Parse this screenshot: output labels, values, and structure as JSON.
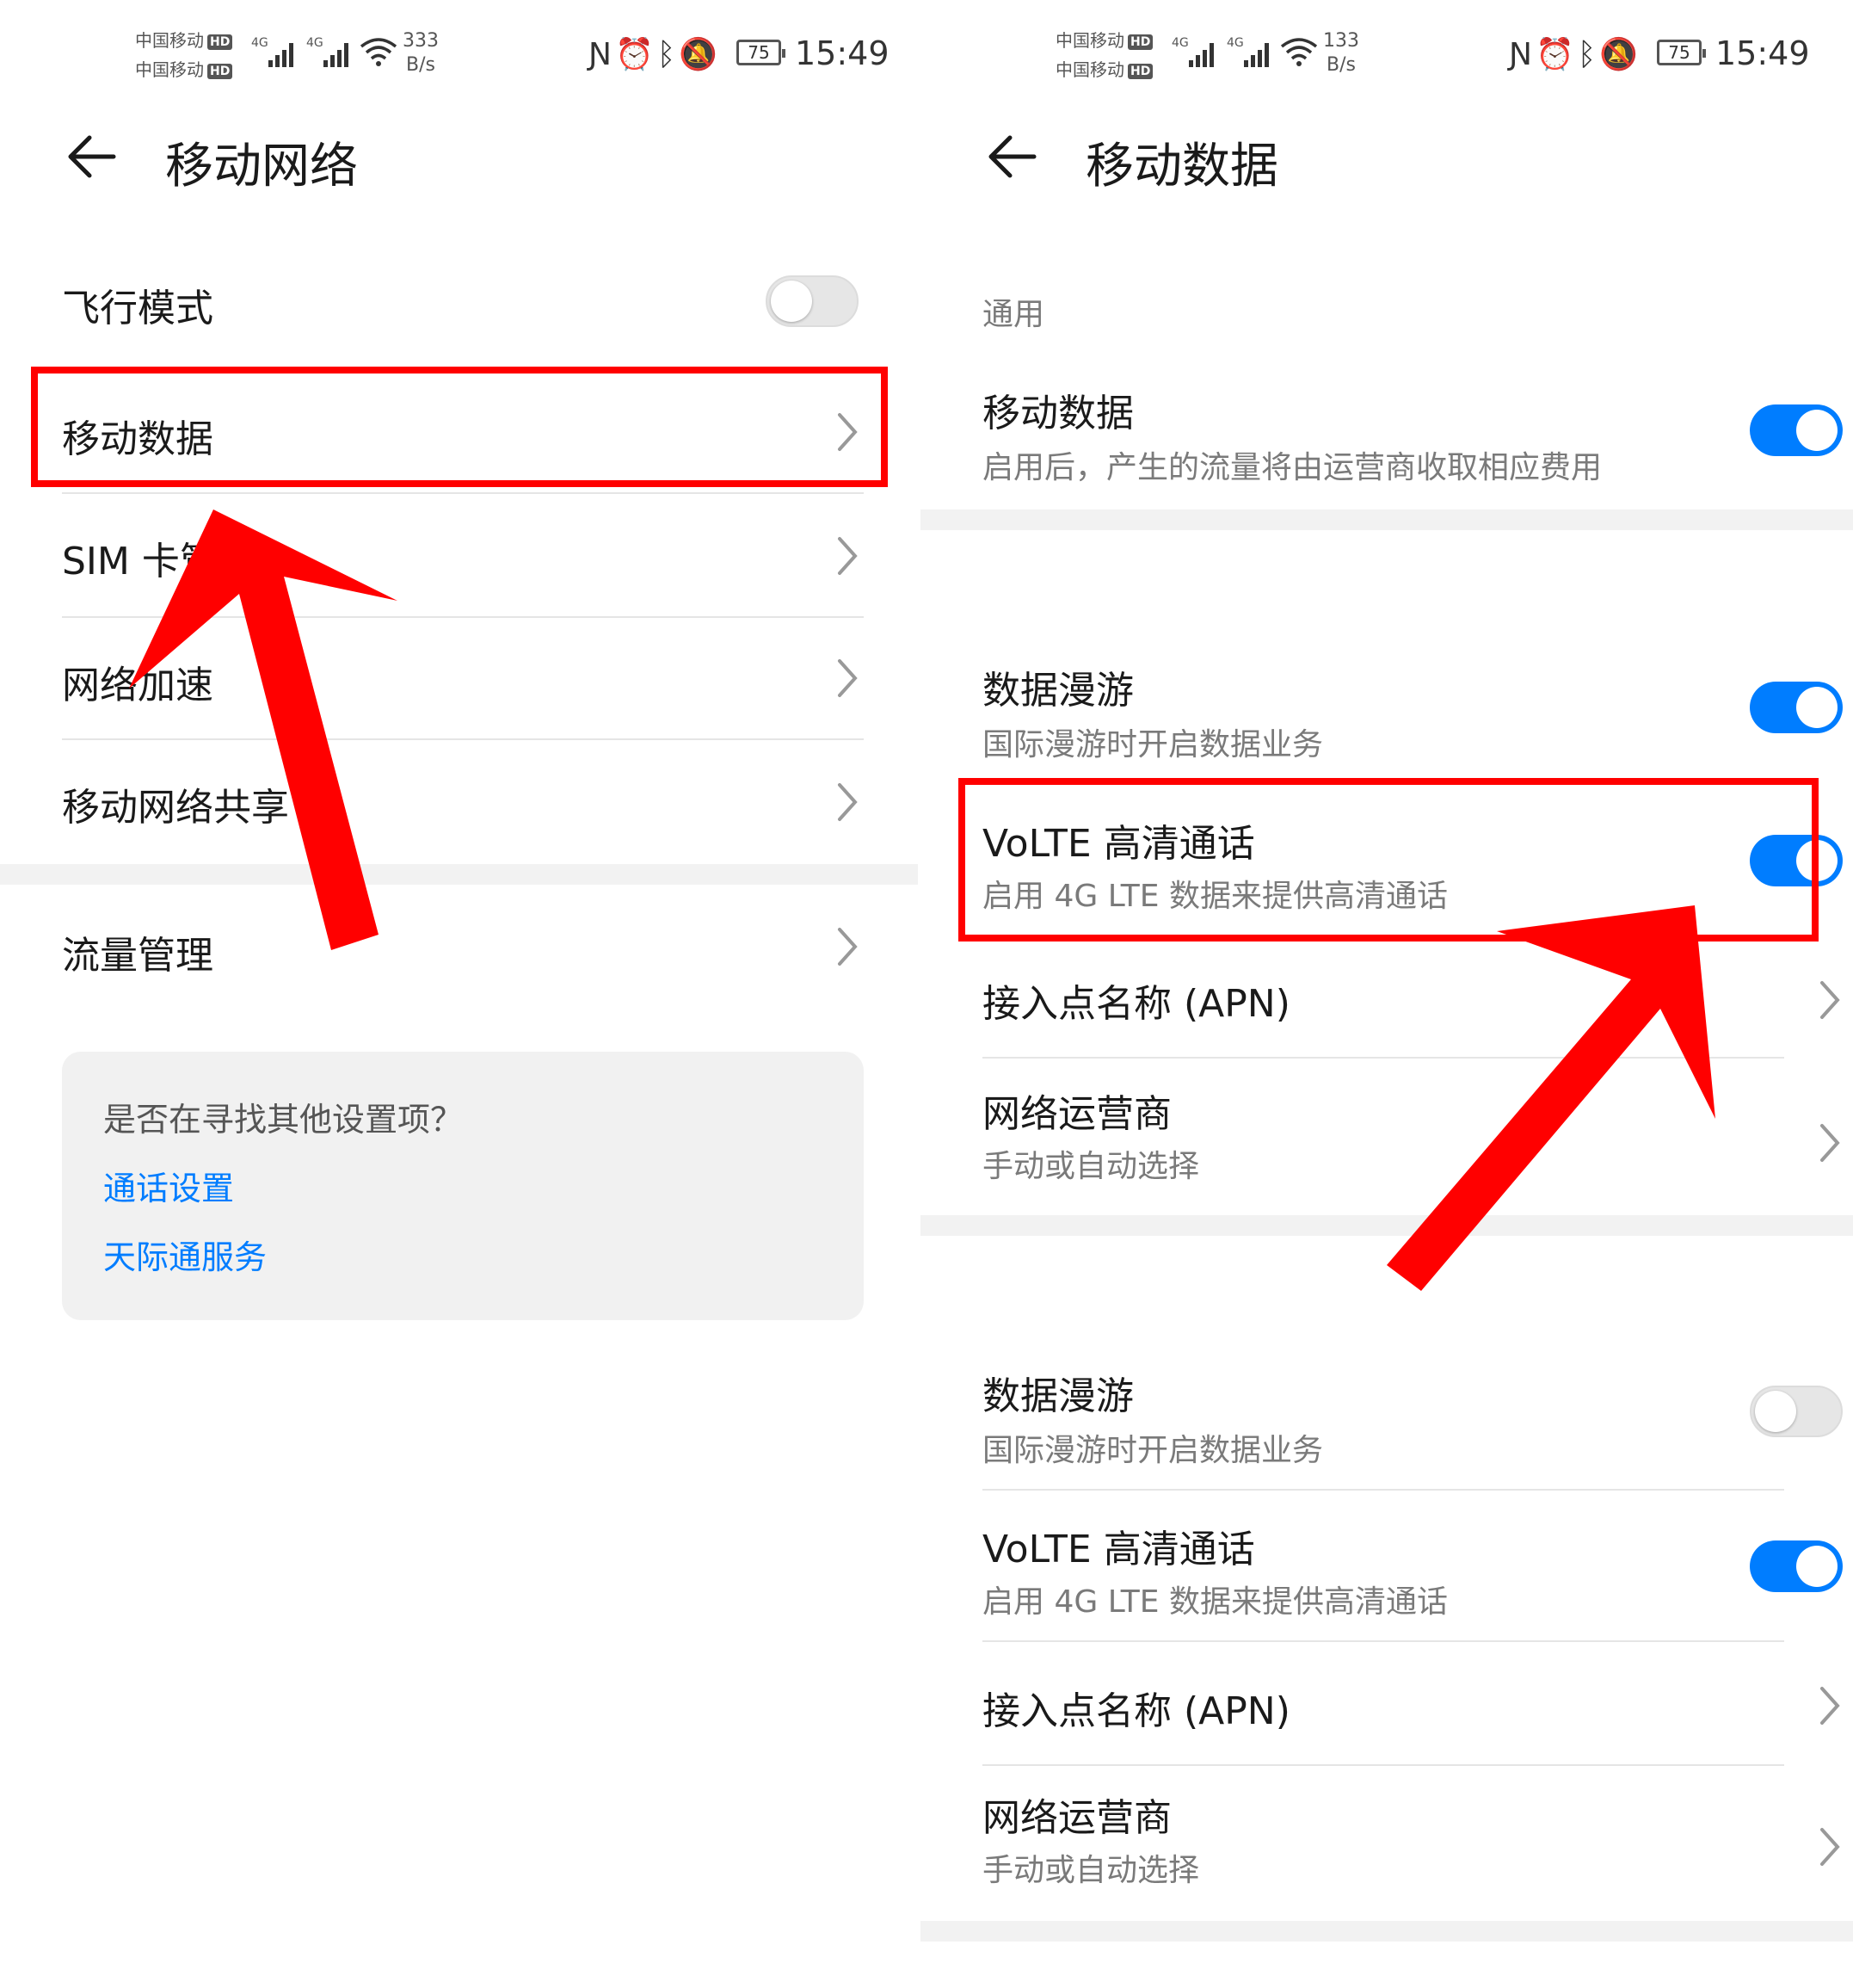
{
  "colors": {
    "accent": "#007dff",
    "highlight": "#ff0000",
    "background": "#ffffff",
    "card": "#f1f1f1"
  },
  "status_left": {
    "carrier1": "中国移动",
    "carrier2": "中国移动",
    "hd_badge": "HD",
    "network1": "4G",
    "network2": "4G",
    "speed_value": "333",
    "speed_unit": "B/s",
    "battery": "75",
    "time": "15:49",
    "icons": [
      "nfc-icon",
      "alarm-icon",
      "bluetooth-icon",
      "mute-icon"
    ]
  },
  "status_right": {
    "carrier1": "中国移动",
    "carrier2": "中国移动",
    "hd_badge": "HD",
    "network1": "4G",
    "network2": "4G",
    "speed_value": "133",
    "speed_unit": "B/s",
    "battery": "75",
    "time": "15:49"
  },
  "left": {
    "title": "移动网络",
    "items": [
      {
        "label": "飞行模式",
        "control": "toggle",
        "state": "off"
      },
      {
        "label": "移动数据",
        "control": "chevron",
        "highlighted": true
      },
      {
        "label": "SIM 卡管理",
        "control": "chevron"
      },
      {
        "label": "网络加速",
        "control": "chevron"
      },
      {
        "label": "移动网络共享",
        "control": "chevron"
      },
      {
        "label": "流量管理",
        "control": "chevron"
      }
    ],
    "help": {
      "question": "是否在寻找其他设置项？",
      "links": [
        "通话设置",
        "天际通服务"
      ]
    }
  },
  "right": {
    "title": "移动数据",
    "general_label": "通用",
    "mobile_data": {
      "title": "移动数据",
      "subtitle": "启用后，产生的流量将由运营商收取相应费用",
      "state": "on"
    },
    "sim1": {
      "roaming": {
        "title": "数据漫游",
        "subtitle": "国际漫游时开启数据业务",
        "state": "on"
      },
      "volte": {
        "title": "VoLTE 高清通话",
        "subtitle": "启用 4G LTE 数据来提供高清通话",
        "state": "on",
        "highlighted": true
      },
      "apn": {
        "title": "接入点名称 (APN)"
      },
      "carrier": {
        "title": "网络运营商",
        "subtitle": "手动或自动选择"
      }
    },
    "sim2": {
      "roaming": {
        "title": "数据漫游",
        "subtitle": "国际漫游时开启数据业务",
        "state": "off"
      },
      "volte": {
        "title": "VoLTE 高清通话",
        "subtitle": "启用 4G LTE 数据来提供高清通话",
        "state": "on"
      },
      "apn": {
        "title": "接入点名称 (APN)"
      },
      "carrier": {
        "title": "网络运营商",
        "subtitle": "手动或自动选择"
      }
    }
  }
}
